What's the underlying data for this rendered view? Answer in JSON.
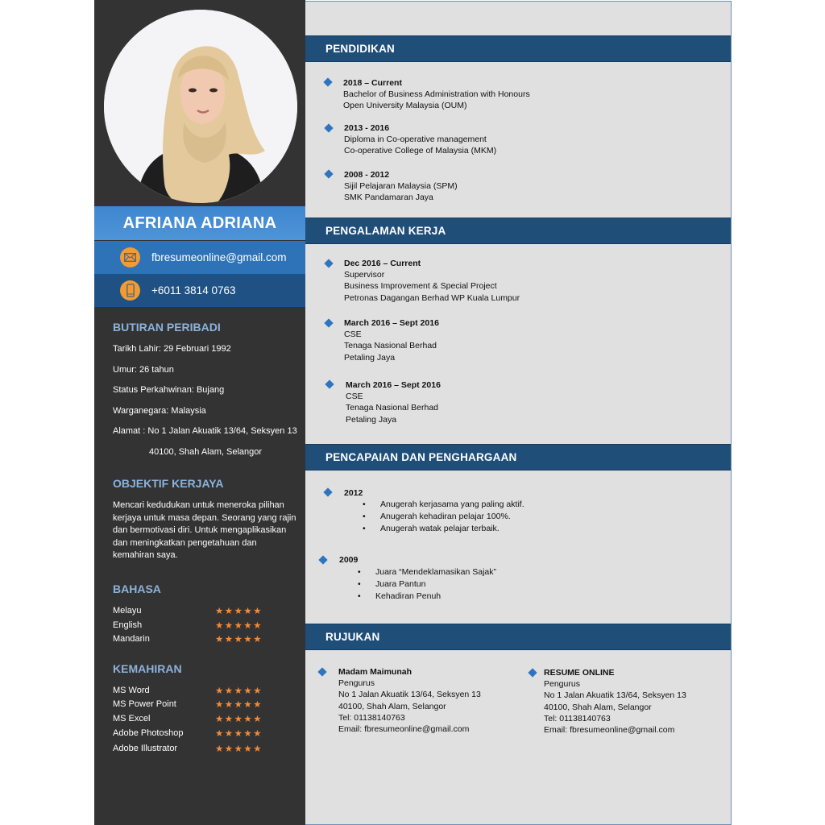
{
  "profile": {
    "name": "AFRIANA ADRIANA",
    "photo_alt": "profile-photo",
    "email": "fbresumeonline@gmail.com",
    "phone": "+6011 3814 0763",
    "email_icon": "envelope-icon",
    "phone_icon": "smartphone-icon"
  },
  "personal": {
    "heading": "BUTIRAN PERIBADI",
    "items": [
      "Tarikh Lahir: 29 Februari 1992",
      "Umur: 26 tahun",
      "Status Perkahwinan: Bujang",
      "Warganegara: Malaysia",
      "Alamat : No 1 Jalan Akuatik 13/64, Seksyen 13",
      "40100, Shah Alam, Selangor"
    ]
  },
  "objective": {
    "heading": "OBJEKTIF KERJAYA",
    "lines": [
      "Mencari kedudukan untuk meneroka pilihan",
      "kerjaya untuk masa depan. Seorang yang rajin",
      "dan bermotivasi diri. Untuk mengaplikasikan",
      "dan meningkatkan pengetahuan dan",
      "kemahiran saya."
    ]
  },
  "languages": {
    "heading": "BAHASA",
    "items": [
      {
        "label": "Melayu",
        "rating": 5,
        "max": 5,
        "stars": "★★★★★"
      },
      {
        "label": "English",
        "rating": 5,
        "max": 5,
        "stars": "★★★★★"
      },
      {
        "label": "Mandarin",
        "rating": 5,
        "max": 5,
        "stars": "★★★★★"
      }
    ]
  },
  "skills": {
    "heading": "KEMAHIRAN",
    "items": [
      {
        "label": "MS Word",
        "rating": 5,
        "max": 5,
        "stars": "★★★★★"
      },
      {
        "label": "MS Power Point",
        "rating": 5,
        "max": 5,
        "stars": "★★★★★"
      },
      {
        "label": "MS Excel",
        "rating": 5,
        "max": 5,
        "stars": "★★★★★"
      },
      {
        "label": "Adobe Photoshop",
        "rating": 5,
        "max": 5,
        "stars": "★★★★★"
      },
      {
        "label": "Adobe Illustrator",
        "rating": 5,
        "max": 5,
        "stars": "★★★★★"
      }
    ]
  },
  "education": {
    "heading": "PENDIDIKAN",
    "entries": [
      {
        "period": "2018 – Current",
        "line1": "Bachelor of Business Administration with Honours",
        "line2": "Open University Malaysia (OUM)"
      },
      {
        "period": "2013 - 2016",
        "line1": "Diploma in Co-operative management",
        "line2": "Co-operative College of Malaysia (MKM)"
      },
      {
        "period": "2008 - 2012",
        "line1": "Sijil Pelajaran Malaysia (SPM)",
        "line2": "SMK Pandamaran Jaya"
      }
    ]
  },
  "experience": {
    "heading": "PENGALAMAN KERJA",
    "entries": [
      {
        "period": "Dec 2016 – Current",
        "lines": [
          "Supervisor",
          "Business Improvement & Special Project",
          "Petronas Dagangan Berhad WP Kuala Lumpur"
        ]
      },
      {
        "period": "March 2016 – Sept 2016",
        "lines": [
          "CSE",
          "Tenaga Nasional Berhad",
          "Petaling Jaya"
        ]
      },
      {
        "period": "March 2016 – Sept 2016",
        "lines": [
          "CSE",
          "Tenaga Nasional Berhad",
          "Petaling Jaya"
        ]
      }
    ]
  },
  "achievements": {
    "heading": "PENCAPAIAN DAN PENGHARGAAN",
    "entries": [
      {
        "year": "2012",
        "items": [
          "Anugerah kerjasama yang paling aktif.",
          "Anugerah kehadiran pelajar 100%.",
          "Anugerah watak pelajar terbaik."
        ]
      },
      {
        "year": "2009",
        "items": [
          "Juara “Mendeklamasikan Sajak”",
          "Juara Pantun",
          "Kehadiran Penuh"
        ]
      }
    ]
  },
  "references": {
    "heading": "RUJUKAN",
    "entries": [
      {
        "name": "Madam Maimunah",
        "lines": [
          "Pengurus",
          "No 1 Jalan Akuatik 13/64, Seksyen 13",
          "40100, Shah Alam, Selangor",
          "Tel: 01138140763",
          "Email: fbresumeonline@gmail.com"
        ]
      },
      {
        "name": "RESUME ONLINE",
        "lines": [
          "Pengurus",
          "No 1 Jalan Akuatik 13/64, Seksyen 13",
          "40100, Shah Alam, Selangor",
          "Tel: 01138140763",
          "Email: fbresumeonline@gmail.com"
        ]
      }
    ]
  },
  "colors": {
    "sidebar_bg": "#333333",
    "name_bar": "#4a90d6",
    "email_bar": "#2e72b8",
    "phone_bar": "#1f5185",
    "section_bar": "#1f4e79",
    "main_bg": "#e0e0e0",
    "accent_heading": "#8cb3dd",
    "star": "#f18a3a",
    "icon_circle": "#f09c34",
    "diamond": "#2e75c0"
  }
}
